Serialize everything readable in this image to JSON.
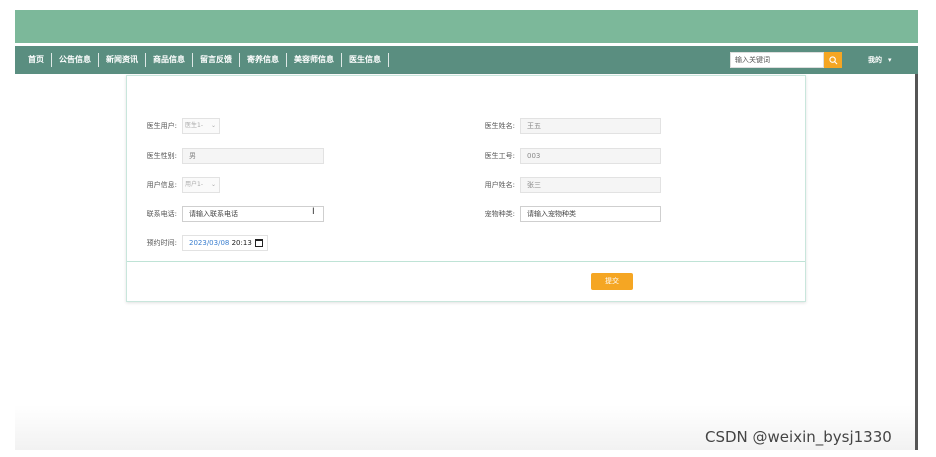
{
  "nav": {
    "items": [
      {
        "label": "首页"
      },
      {
        "label": "公告信息"
      },
      {
        "label": "新闻资讯"
      },
      {
        "label": "商品信息"
      },
      {
        "label": "留言反馈"
      },
      {
        "label": "寄养信息"
      },
      {
        "label": "美容师信息"
      },
      {
        "label": "医生信息"
      }
    ],
    "search_placeholder": "输入关键词",
    "user_label": "我的",
    "user_caret": "▾"
  },
  "form": {
    "doctor_user": {
      "label": "医生用户:",
      "value": "医生1-"
    },
    "doctor_name": {
      "label": "医生姓名:",
      "value": "王五"
    },
    "doctor_gender": {
      "label": "医生性别:",
      "value": "男"
    },
    "doctor_id": {
      "label": "医生工号:",
      "value": "003"
    },
    "user_info": {
      "label": "用户信息:",
      "value": "用户1-"
    },
    "user_name": {
      "label": "用户姓名:",
      "value": "张三"
    },
    "phone": {
      "label": "联系电话:",
      "value": "请输入联系电话"
    },
    "pet_type": {
      "label": "宠物种类:",
      "value": "请输入宠物种类"
    },
    "appointment": {
      "label": "预约时间:",
      "date": "2023/03/08",
      "time": "20:13"
    },
    "submit_label": "提交"
  },
  "watermark": "CSDN @weixin_bysj1330",
  "colors": {
    "banner": "#7cb89a",
    "navbar": "#5a8e80",
    "accent": "#f5a623"
  }
}
